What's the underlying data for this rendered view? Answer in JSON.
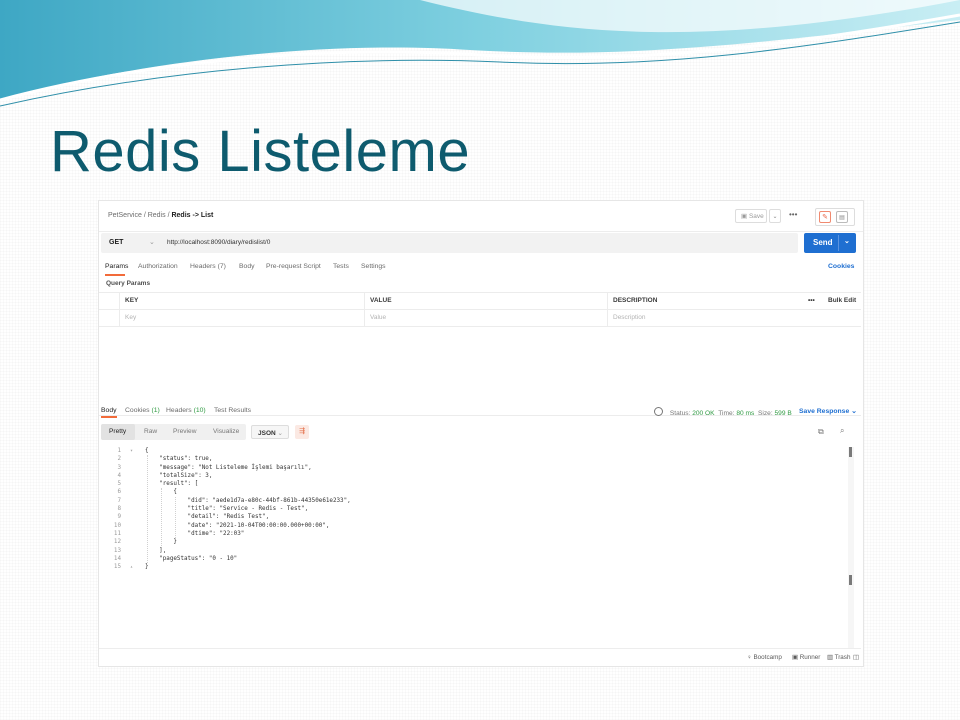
{
  "slide": {
    "title": "Redis Listeleme"
  },
  "header": {
    "breadcrumb": [
      "PetService",
      "Redis"
    ],
    "current": "Redis -> List",
    "separator": "/",
    "save_label": "Save",
    "more_icon": "more-horizontal-icon"
  },
  "request": {
    "method": "GET",
    "url": "http://localhost:8090/diary/redislist/0",
    "send_label": "Send"
  },
  "request_tabs": [
    "Params",
    "Authorization",
    "Headers (7)",
    "Body",
    "Pre-request Script",
    "Tests",
    "Settings"
  ],
  "cookies_label": "Cookies",
  "query_params": {
    "title": "Query Params",
    "columns": [
      "KEY",
      "VALUE",
      "DESCRIPTION"
    ],
    "more": "•••",
    "bulk_edit": "Bulk Edit",
    "placeholders": [
      "Key",
      "Value",
      "Description"
    ]
  },
  "response_tabs": {
    "body": "Body",
    "cookies": "Cookies",
    "cookies_count": "(1)",
    "headers": "Headers",
    "headers_count": "(10)",
    "tests": "Test Results"
  },
  "response_status": {
    "status_label": "Status:",
    "status_value": "200 OK",
    "time_label": "Time:",
    "time_value": "80 ms",
    "size_label": "Size:",
    "size_value": "599 B",
    "save_response": "Save Response"
  },
  "view": {
    "modes": [
      "Pretty",
      "Raw",
      "Preview",
      "Visualize"
    ],
    "format": "JSON"
  },
  "code_lines": [
    "{",
    "    \"status\": true,",
    "    \"message\": \"Not Listeleme İşlemi başarılı\",",
    "    \"totalSize\": 3,",
    "    \"result\": [",
    "        {",
    "            \"did\": \"aede1d7a-e80c-44bf-861b-44350e61e233\",",
    "            \"title\": \"Service - Redis - Test\",",
    "            \"detail\": \"Redis Test\",",
    "            \"date\": \"2021-10-04T00:00:00.000+00:00\",",
    "            \"dtime\": \"22:03\"",
    "        }",
    "    ],",
    "    \"pageStatus\": \"0 - 10\"",
    "}"
  ],
  "footer": {
    "bootcamp": "Bootcamp",
    "runner": "Runner",
    "trash": "Trash"
  },
  "colors": {
    "title": "#0e5b6e",
    "send": "#1f6fd1",
    "accent": "#f26b3a",
    "ok": "#2f9a42"
  }
}
